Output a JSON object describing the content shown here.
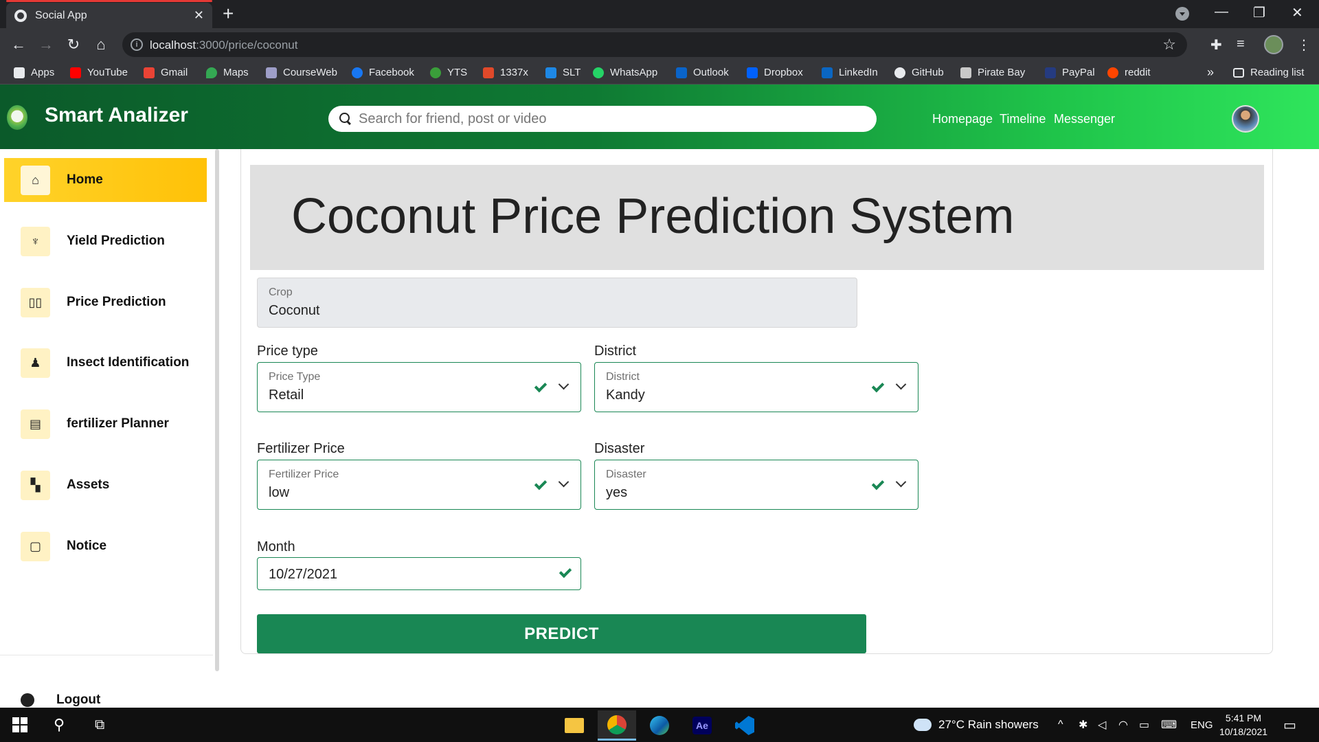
{
  "browser": {
    "tab_title": "Social App",
    "url_host": "localhost",
    "url_path": ":3000/price/coconut",
    "bookmarks": [
      "Apps",
      "YouTube",
      "Gmail",
      "Maps",
      "CourseWeb",
      "Facebook",
      "YTS",
      "1337x",
      "SLT",
      "WhatsApp",
      "Outlook",
      "Dropbox",
      "LinkedIn",
      "GitHub",
      "Pirate Bay",
      "PayPal",
      "reddit"
    ],
    "more": "»",
    "reading_list": "Reading list"
  },
  "header": {
    "brand": "Smart Analizer",
    "search_placeholder": "Search for friend, post or video",
    "nav": [
      "Homepage",
      "Timeline",
      "Messenger"
    ]
  },
  "sidebar": {
    "items": [
      {
        "label": "Home",
        "icon": "home-icon",
        "active": true
      },
      {
        "label": "Yield Prediction",
        "icon": "plant-icon",
        "active": false
      },
      {
        "label": "Price Prediction",
        "icon": "book-icon",
        "active": false
      },
      {
        "label": "Insect Identification",
        "icon": "person-icon",
        "active": false
      },
      {
        "label": "fertilizer Planner",
        "icon": "document-icon",
        "active": false
      },
      {
        "label": "Assets",
        "icon": "sitemap-icon",
        "active": false
      },
      {
        "label": "Notice",
        "icon": "file-icon",
        "active": false
      }
    ],
    "logout": "Logout"
  },
  "main": {
    "title": "Coconut Price Prediction System",
    "crop": {
      "caption": "Crop",
      "value": "Coconut"
    },
    "price_type": {
      "label": "Price type",
      "caption": "Price Type",
      "value": "Retail"
    },
    "district": {
      "label": "District",
      "caption": "District",
      "value": "Kandy"
    },
    "fertilizer_price": {
      "label": "Fertilizer Price",
      "caption": "Fertilizer Price",
      "value": "low"
    },
    "disaster": {
      "label": "Disaster",
      "caption": "Disaster",
      "value": "yes"
    },
    "month": {
      "label": "Month",
      "value": "10/27/2021"
    },
    "predict_label": "PREDICT"
  },
  "taskbar": {
    "weather": "27°C  Rain showers",
    "lang": "ENG",
    "time": "5:41 PM",
    "date": "10/18/2021"
  },
  "colors": {
    "accent_green": "#198754",
    "active_yellow": "#ffc107",
    "header_gradient_start": "#0b5a2a",
    "header_gradient_end": "#2fe55c"
  }
}
